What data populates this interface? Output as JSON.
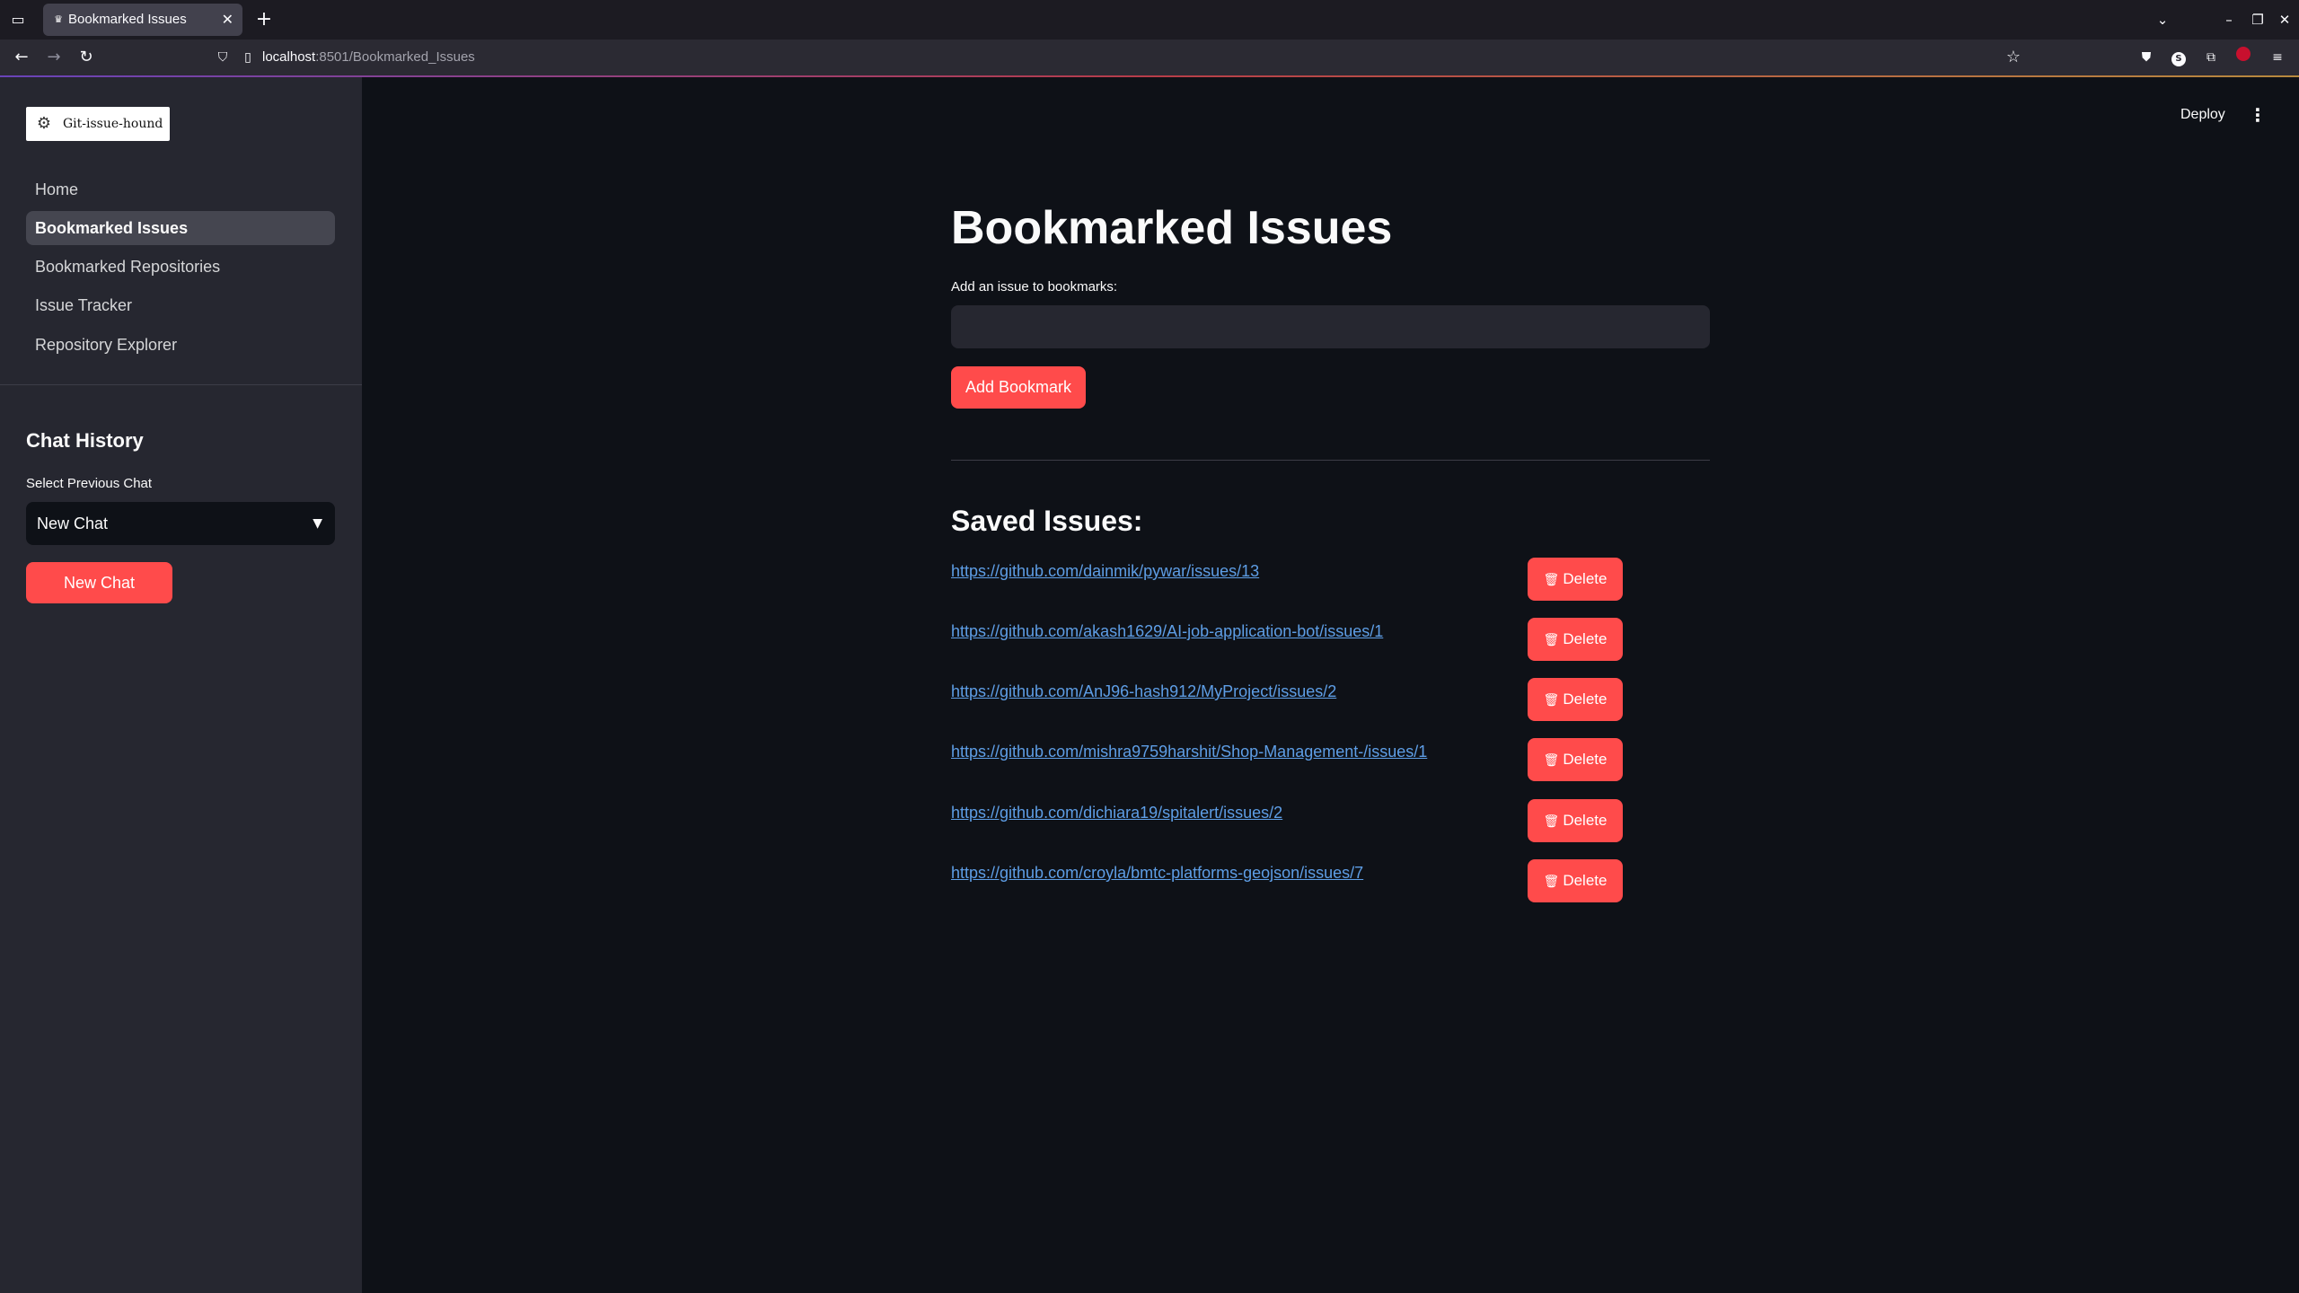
{
  "browser": {
    "tab_title": "Bookmarked Issues",
    "url_host": "localhost",
    "url_rest": ":8501/Bookmarked_Issues"
  },
  "sidebar": {
    "logo_text": "Git-issue-hound",
    "nav_items": [
      {
        "label": "Home"
      },
      {
        "label": "Bookmarked Issues"
      },
      {
        "label": "Bookmarked Repositories"
      },
      {
        "label": "Issue Tracker"
      },
      {
        "label": "Repository Explorer"
      }
    ],
    "active_item": "Bookmarked Issues",
    "chat_heading": "Chat History",
    "select_label": "Select Previous Chat",
    "select_value": "New Chat",
    "new_chat_label": "New Chat"
  },
  "header": {
    "deploy_label": "Deploy"
  },
  "main": {
    "title": "Bookmarked Issues",
    "input_label": "Add an issue to bookmarks:",
    "input_value": "",
    "add_button_label": "Add Bookmark",
    "saved_heading": "Saved Issues:",
    "delete_label": "Delete",
    "issues": [
      {
        "url": "https://github.com/dainmik/pywar/issues/13"
      },
      {
        "url": "https://github.com/akash1629/AI-job-application-bot/issues/1"
      },
      {
        "url": "https://github.com/AnJ96-hash912/MyProject/issues/2"
      },
      {
        "url": "https://github.com/mishra9759harshit/Shop-Management-/issues/1"
      },
      {
        "url": "https://github.com/dichiara19/spitalert/issues/2"
      },
      {
        "url": "https://github.com/croyla/bmtc-platforms-geojson/issues/7"
      }
    ]
  },
  "colors": {
    "accent": "#ff4b4b",
    "background": "#0e1117",
    "sidebar": "#262730",
    "link": "#5e9ee6"
  }
}
